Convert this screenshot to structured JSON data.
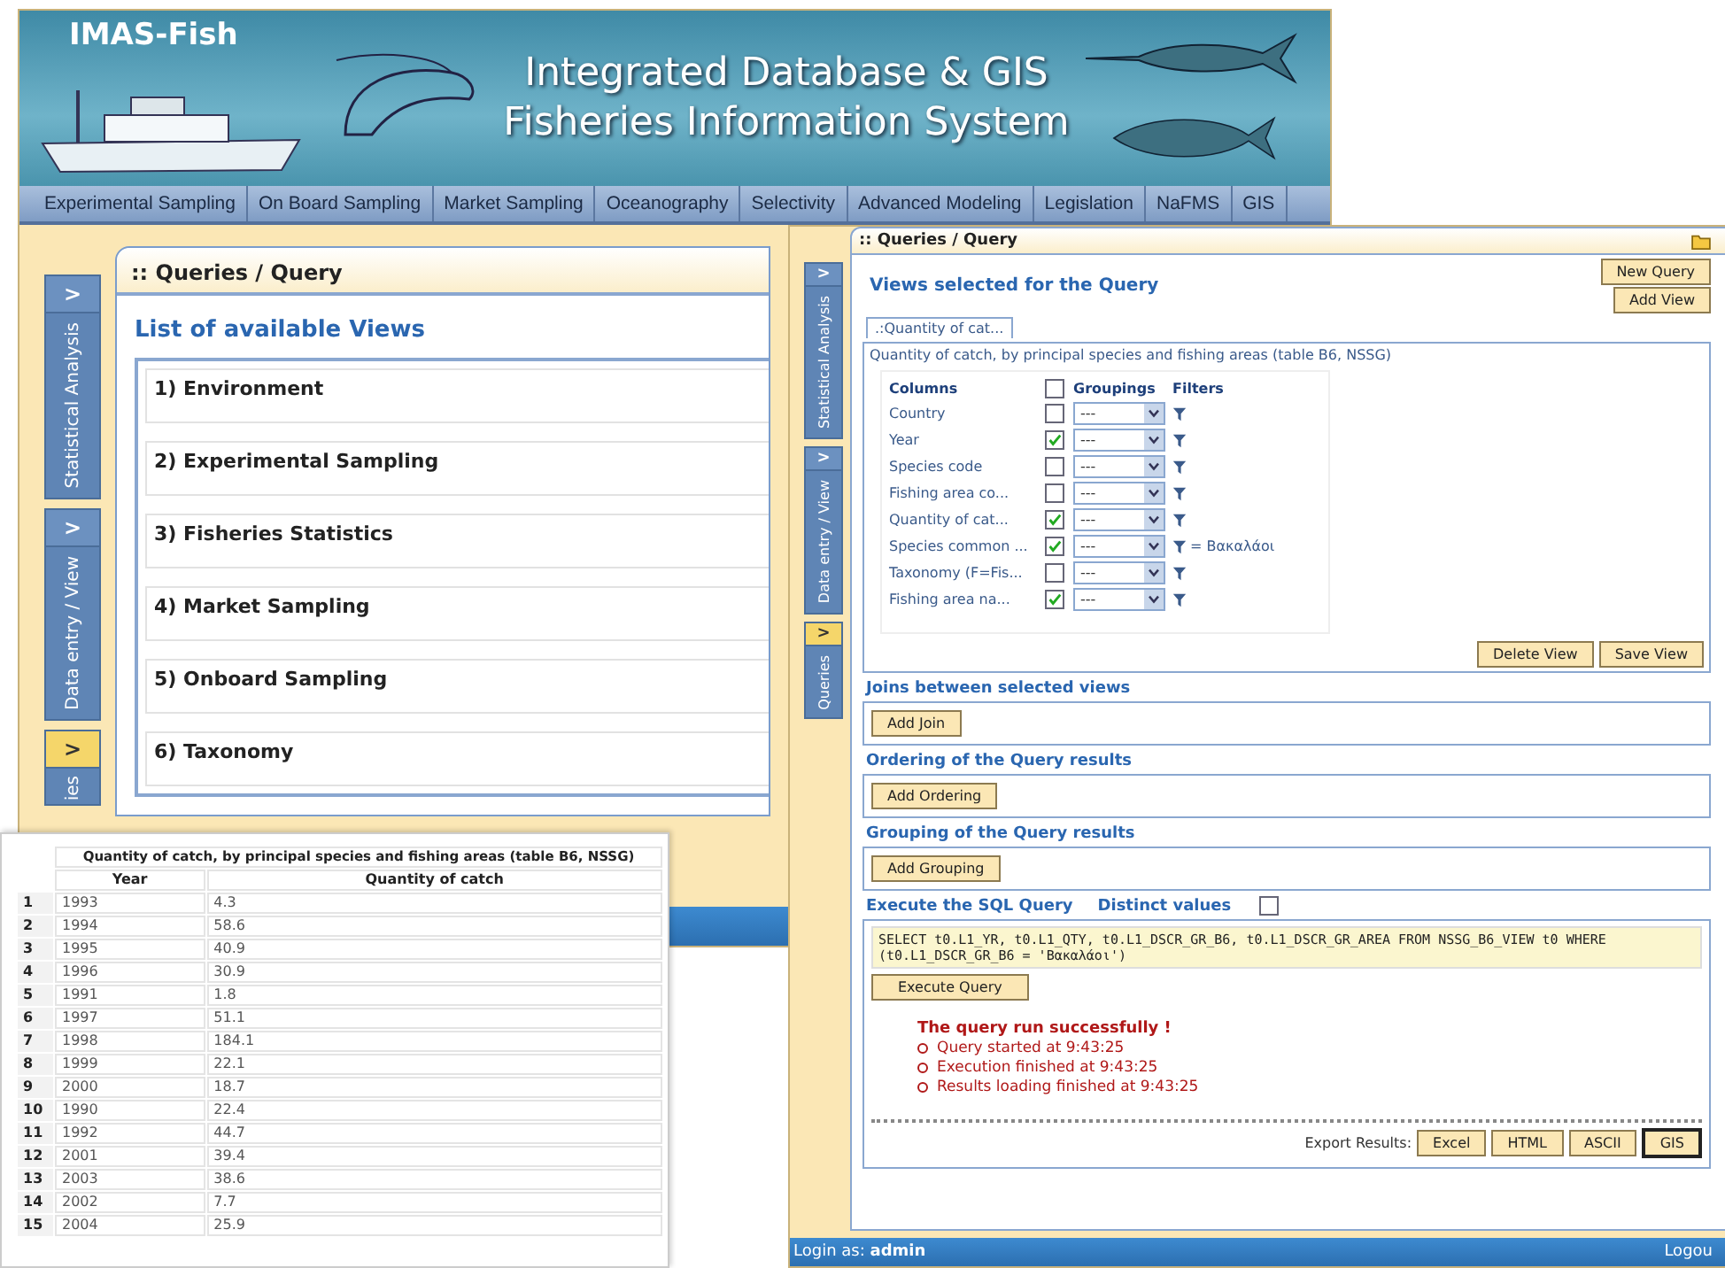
{
  "back_window": {
    "banner": {
      "logo": "IMAS-Fish",
      "title_line_1": "Integrated Database & GIS",
      "title_line_2": "Fisheries Information System"
    },
    "nav_tabs": [
      "Experimental Sampling",
      "On Board Sampling",
      "Market Sampling",
      "Oceanography",
      "Selectivity",
      "Advanced Modeling",
      "Legislation",
      "NaFMS",
      "GIS"
    ],
    "side_tabs": [
      {
        "toggle": ">",
        "label": "Statistical Analysis",
        "selected": false
      },
      {
        "toggle": ">",
        "label": "Data entry / View",
        "selected": false
      },
      {
        "toggle": ">",
        "label": "ies",
        "selected": true
      }
    ],
    "breadcrumb": ":: Queries / Query",
    "heading": "List of available Views",
    "views": [
      "1) Environment",
      "2) Experimental Sampling",
      "3) Fisheries Statistics",
      "4) Market Sampling",
      "5) Onboard Sampling",
      "6) Taxonomy"
    ]
  },
  "query_window": {
    "breadcrumb": ":: Queries / Query",
    "side_tabs": [
      {
        "toggle": ">",
        "label": "Statistical Analysis",
        "selected": false
      },
      {
        "toggle": ">",
        "label": "Data entry / View",
        "selected": false
      },
      {
        "toggle": ">",
        "label": "Queries",
        "selected": true
      }
    ],
    "views_heading": "Views selected for the Query",
    "new_query_button": "New Query",
    "add_view_button": "Add View",
    "view_tab": ".:Quantity of cat...",
    "view_description": "Quantity of catch, by principal species and fishing areas (table B6, NSSG)",
    "column_headers": {
      "columns": "Columns",
      "groupings": "Groupings",
      "groupings_all_checked": false,
      "filters": "Filters"
    },
    "columns": [
      {
        "name": "Country",
        "checked": false,
        "grouping": "---"
      },
      {
        "name": "Year",
        "checked": true,
        "grouping": "---"
      },
      {
        "name": "Species code",
        "checked": false,
        "grouping": "---"
      },
      {
        "name": "Fishing area co...",
        "checked": false,
        "grouping": "---"
      },
      {
        "name": "Quantity of cat...",
        "checked": true,
        "grouping": "---"
      },
      {
        "name": "Species common ...",
        "checked": true,
        "grouping": "---",
        "filter": "= Βακαλάοι"
      },
      {
        "name": "Taxonomy (F=Fis...",
        "checked": false,
        "grouping": "---"
      },
      {
        "name": "Fishing area na...",
        "checked": true,
        "grouping": "---"
      }
    ],
    "delete_view_button": "Delete View",
    "save_view_button": "Save View",
    "sections": [
      {
        "heading": "Joins between selected views",
        "button": "Add Join"
      },
      {
        "heading": "Ordering of the Query results",
        "button": "Add Ordering"
      },
      {
        "heading": "Grouping of the Query results",
        "button": "Add Grouping"
      }
    ],
    "execute_heading": "Execute the SQL Query",
    "distinct_label": "Distinct values",
    "distinct_checked": false,
    "sql": "SELECT t0.L1_YR, t0.L1_QTY, t0.L1_DSCR_GR_B6, t0.L1_DSCR_GR_AREA FROM NSSG_B6_VIEW t0 WHERE (t0.L1_DSCR_GR_B6 = 'Βακαλάοι')",
    "execute_button": "Execute Query",
    "success_message": "The query run successfully !",
    "log": [
      "Query started at 9:43:25",
      "Execution finished at 9:43:25",
      "Results loading finished at 9:43:25"
    ],
    "export_label": "Export Results:",
    "export_buttons": [
      {
        "label": "Excel",
        "selected": false
      },
      {
        "label": "HTML",
        "selected": false
      },
      {
        "label": "ASCII",
        "selected": false
      },
      {
        "label": "GIS",
        "selected": true
      }
    ],
    "status_bar": {
      "login_label": "Login as:",
      "user": "admin",
      "logout": "Logou"
    }
  },
  "result_table": {
    "title": "Quantity of catch, by principal species and fishing areas (table B6, NSSG)",
    "columns": [
      "",
      "Year",
      "Quantity of catch"
    ],
    "rows": [
      [
        "1",
        "1993",
        "4.3"
      ],
      [
        "2",
        "1994",
        "58.6"
      ],
      [
        "3",
        "1995",
        "40.9"
      ],
      [
        "4",
        "1996",
        "30.9"
      ],
      [
        "5",
        "1991",
        "1.8"
      ],
      [
        "6",
        "1997",
        "51.1"
      ],
      [
        "7",
        "1998",
        "184.1"
      ],
      [
        "8",
        "1999",
        "22.1"
      ],
      [
        "9",
        "2000",
        "18.7"
      ],
      [
        "10",
        "1990",
        "22.4"
      ],
      [
        "11",
        "1992",
        "44.7"
      ],
      [
        "12",
        "2001",
        "39.4"
      ],
      [
        "13",
        "2003",
        "38.6"
      ],
      [
        "14",
        "2002",
        "7.7"
      ],
      [
        "15",
        "2004",
        "25.9"
      ]
    ]
  }
}
